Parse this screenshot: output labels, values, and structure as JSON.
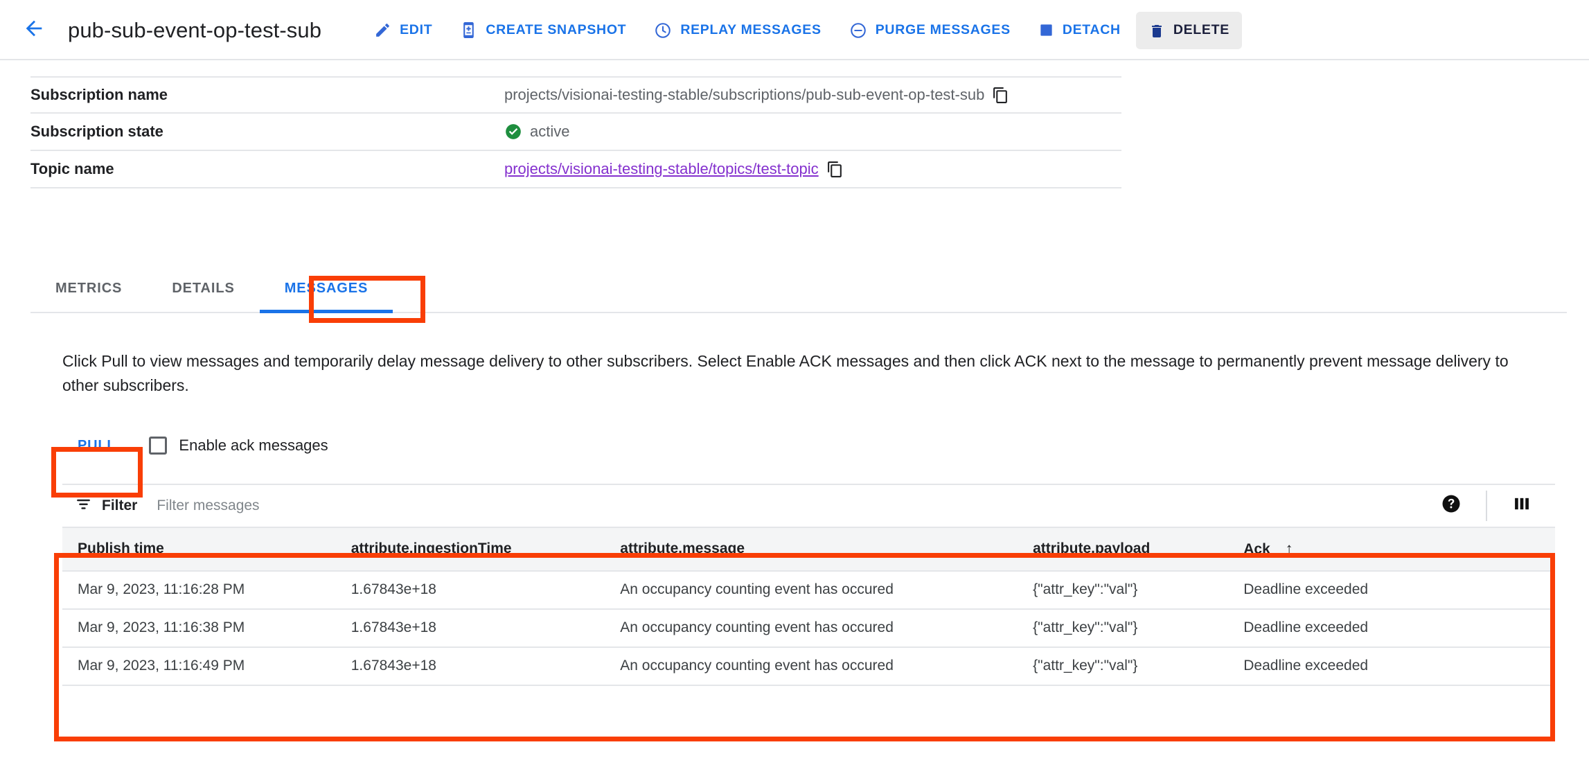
{
  "header": {
    "back_icon": "arrow-left-icon",
    "title": "pub-sub-event-op-test-sub",
    "actions": [
      {
        "label": "EDIT",
        "icon": "pencil-icon",
        "state": "normal"
      },
      {
        "label": "CREATE SNAPSHOT",
        "icon": "snapshot-icon",
        "state": "normal"
      },
      {
        "label": "REPLAY MESSAGES",
        "icon": "clock-icon",
        "state": "normal"
      },
      {
        "label": "PURGE MESSAGES",
        "icon": "minus-circle-icon",
        "state": "normal"
      },
      {
        "label": "DETACH",
        "icon": "square-icon",
        "state": "normal"
      },
      {
        "label": "DELETE",
        "icon": "trash-icon",
        "state": "hovered"
      }
    ]
  },
  "properties": [
    {
      "label": "Subscription name",
      "value": "projects/visionai-testing-stable/subscriptions/pub-sub-event-op-test-sub",
      "is_link": false,
      "has_copy": true,
      "status_icon": null
    },
    {
      "label": "Subscription state",
      "value": "active",
      "is_link": false,
      "has_copy": false,
      "status_icon": "check-circle-icon"
    },
    {
      "label": "Topic name",
      "value": "projects/visionai-testing-stable/topics/test-topic",
      "is_link": true,
      "has_copy": true,
      "status_icon": null
    }
  ],
  "tabs": [
    {
      "label": "METRICS",
      "active": false
    },
    {
      "label": "DETAILS",
      "active": false
    },
    {
      "label": "MESSAGES",
      "active": true
    }
  ],
  "description": "Click Pull to view messages and temporarily delay message delivery to other subscribers. Select Enable ACK messages and then click ACK next to the message to permanently prevent message delivery to other subscribers.",
  "controls": {
    "pull_label": "PULL",
    "ack_checkbox_label": "Enable ack messages",
    "ack_checkbox_checked": false
  },
  "filter_bar": {
    "filter_icon": "filter-icon",
    "filter_label": "Filter",
    "filter_placeholder": "Filter messages",
    "filter_value": "",
    "help_icon": "help-filled-icon",
    "columns_icon": "column-display-icon"
  },
  "messages_table": {
    "columns": [
      {
        "label": "Publish time",
        "sorted": false
      },
      {
        "label": "attribute.ingestionTime",
        "sorted": false
      },
      {
        "label": "attribute.message",
        "sorted": false
      },
      {
        "label": "attribute.payload",
        "sorted": false
      },
      {
        "label": "Ack",
        "sorted": true,
        "sort_direction": "↑"
      }
    ],
    "rows": [
      {
        "publish_time": "Mar 9, 2023, 11:16:28 PM",
        "ingestion_time": "1.67843e+18",
        "message": "An occupancy counting event has occured",
        "payload": "{\"attr_key\":\"val\"}",
        "ack": "Deadline exceeded"
      },
      {
        "publish_time": "Mar 9, 2023, 11:16:38 PM",
        "ingestion_time": "1.67843e+18",
        "message": "An occupancy counting event has occured",
        "payload": "{\"attr_key\":\"val\"}",
        "ack": "Deadline exceeded"
      },
      {
        "publish_time": "Mar 9, 2023, 11:16:49 PM",
        "ingestion_time": "1.67843e+18",
        "message": "An occupancy counting event has occured",
        "payload": "{\"attr_key\":\"val\"}",
        "ack": "Deadline exceeded"
      }
    ]
  },
  "annotations": {
    "color": "#f93e06",
    "boxes": [
      {
        "target": "messages-tab"
      },
      {
        "target": "pull-button"
      },
      {
        "target": "messages-table"
      }
    ]
  },
  "colors": {
    "accent_blue": "#1a73e8",
    "link_purple": "#8430ce",
    "status_green": "#1e8e3e",
    "annotation_red": "#f93e06",
    "text_primary": "#202124",
    "text_secondary": "#5f6368"
  }
}
